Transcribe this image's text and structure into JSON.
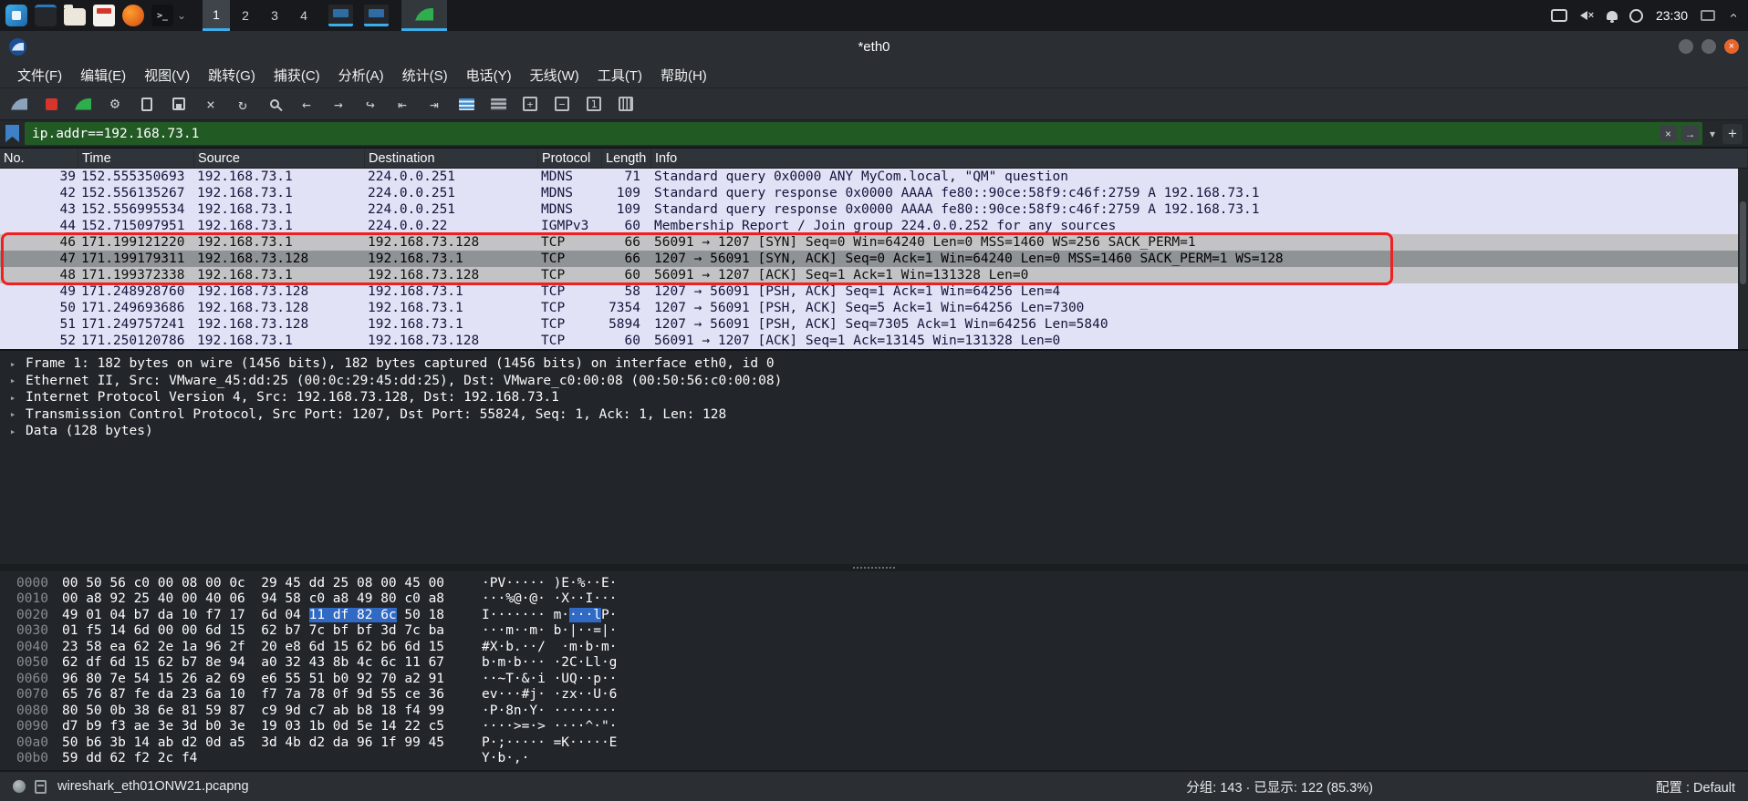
{
  "taskbar": {
    "pager": [
      {
        "id": "desktop-1",
        "label": "1",
        "active": true
      },
      {
        "id": "desktop-2",
        "label": "2",
        "active": false
      },
      {
        "id": "desktop-3",
        "label": "3",
        "active": false
      },
      {
        "id": "desktop-4",
        "label": "4",
        "active": false
      }
    ],
    "clock": "23:30"
  },
  "window": {
    "title": "*eth0"
  },
  "menu": {
    "items": [
      {
        "id": "file",
        "label": "文件(F)"
      },
      {
        "id": "edit",
        "label": "编辑(E)"
      },
      {
        "id": "view",
        "label": "视图(V)"
      },
      {
        "id": "go",
        "label": "跳转(G)"
      },
      {
        "id": "capture",
        "label": "捕获(C)"
      },
      {
        "id": "analyze",
        "label": "分析(A)"
      },
      {
        "id": "statistics",
        "label": "统计(S)"
      },
      {
        "id": "telephony",
        "label": "电话(Y)"
      },
      {
        "id": "wireless",
        "label": "无线(W)"
      },
      {
        "id": "tools",
        "label": "工具(T)"
      },
      {
        "id": "help",
        "label": "帮助(H)"
      }
    ]
  },
  "toolbar": {
    "icons": [
      {
        "name": "start-capture",
        "shape": "fin-blue"
      },
      {
        "name": "stop-capture",
        "shape": "square-red"
      },
      {
        "name": "restart-capture",
        "shape": "fin-green"
      },
      {
        "name": "capture-options",
        "shape": "gear",
        "char": "⚙"
      },
      {
        "name": "open-file",
        "shape": "doc"
      },
      {
        "name": "save-file",
        "shape": "save"
      },
      {
        "name": "close-file",
        "shape": "glyph",
        "char": "×"
      },
      {
        "name": "reload-file",
        "shape": "glyph",
        "char": "↻"
      },
      {
        "name": "find-packet",
        "shape": "magnifier"
      },
      {
        "name": "go-back",
        "shape": "glyph",
        "char": "←"
      },
      {
        "name": "go-forward",
        "shape": "glyph",
        "char": "→"
      },
      {
        "name": "go-to-packet",
        "shape": "glyph",
        "char": "↪"
      },
      {
        "name": "go-first-packet",
        "shape": "glyph",
        "char": "⇤"
      },
      {
        "name": "go-last-packet",
        "shape": "glyph",
        "char": "⇥"
      },
      {
        "name": "colorize-packets",
        "shape": "stripes-blue"
      },
      {
        "name": "auto-scroll",
        "shape": "stripes-gray"
      },
      {
        "name": "zoom-in",
        "shape": "box",
        "char": "+"
      },
      {
        "name": "zoom-out",
        "shape": "box",
        "char": "−"
      },
      {
        "name": "zoom-100",
        "shape": "box",
        "char": "1"
      },
      {
        "name": "resize-columns",
        "shape": "cols"
      }
    ]
  },
  "filter": {
    "value": "ip.addr==192.168.73.1",
    "add_button": "+"
  },
  "packet_list": {
    "columns": [
      "No.",
      "Time",
      "Source",
      "Destination",
      "Protocol",
      "Length",
      "Info"
    ],
    "rows": [
      {
        "no": "39",
        "time": "152.555350693",
        "src": "192.168.73.1",
        "dst": "224.0.0.251",
        "proto": "MDNS",
        "len": "71",
        "info": "Standard query 0x0000 ANY MyCom.local, \"QM\" question",
        "style": "mdns"
      },
      {
        "no": "42",
        "time": "152.556135267",
        "src": "192.168.73.1",
        "dst": "224.0.0.251",
        "proto": "MDNS",
        "len": "109",
        "info": "Standard query response 0x0000 AAAA fe80::90ce:58f9:c46f:2759 A 192.168.73.1",
        "style": "mdns"
      },
      {
        "no": "43",
        "time": "152.556995534",
        "src": "192.168.73.1",
        "dst": "224.0.0.251",
        "proto": "MDNS",
        "len": "109",
        "info": "Standard query response 0x0000 AAAA fe80::90ce:58f9:c46f:2759 A 192.168.73.1",
        "style": "mdns"
      },
      {
        "no": "44",
        "time": "152.715097951",
        "src": "192.168.73.1",
        "dst": "224.0.0.22",
        "proto": "IGMPv3",
        "len": "60",
        "info": "Membership Report / Join group 224.0.0.252 for any sources",
        "style": "mdns"
      },
      {
        "no": "46",
        "time": "171.199121220",
        "src": "192.168.73.1",
        "dst": "192.168.73.128",
        "proto": "TCP",
        "len": "66",
        "info": "56091 → 1207 [SYN] Seq=0 Win=64240 Len=0 MSS=1460 WS=256 SACK_PERM=1",
        "style": "syn"
      },
      {
        "no": "47",
        "time": "171.199179311",
        "src": "192.168.73.128",
        "dst": "192.168.73.1",
        "proto": "TCP",
        "len": "66",
        "info": "1207 → 56091 [SYN, ACK] Seq=0 Ack=1 Win=64240 Len=0 MSS=1460 SACK_PERM=1 WS=128",
        "style": "selected"
      },
      {
        "no": "48",
        "time": "171.199372338",
        "src": "192.168.73.1",
        "dst": "192.168.73.128",
        "proto": "TCP",
        "len": "60",
        "info": "56091 → 1207 [ACK] Seq=1 Ack=1 Win=131328 Len=0",
        "style": "syn"
      },
      {
        "no": "49",
        "time": "171.248928760",
        "src": "192.168.73.128",
        "dst": "192.168.73.1",
        "proto": "TCP",
        "len": "58",
        "info": "1207 → 56091 [PSH, ACK] Seq=1 Ack=1 Win=64256 Len=4",
        "style": "tcp"
      },
      {
        "no": "50",
        "time": "171.249693686",
        "src": "192.168.73.128",
        "dst": "192.168.73.1",
        "proto": "TCP",
        "len": "7354",
        "info": "1207 → 56091 [PSH, ACK] Seq=5 Ack=1 Win=64256 Len=7300",
        "style": "tcp"
      },
      {
        "no": "51",
        "time": "171.249757241",
        "src": "192.168.73.128",
        "dst": "192.168.73.1",
        "proto": "TCP",
        "len": "5894",
        "info": "1207 → 56091 [PSH, ACK] Seq=7305 Ack=1 Win=64256 Len=5840",
        "style": "tcp"
      },
      {
        "no": "52",
        "time": "171.250120786",
        "src": "192.168.73.1",
        "dst": "192.168.73.128",
        "proto": "TCP",
        "len": "60",
        "info": "56091 → 1207 [ACK] Seq=1 Ack=13145 Win=131328 Len=0",
        "style": "tcp"
      }
    ]
  },
  "details": {
    "rows": [
      "Frame 1: 182 bytes on wire (1456 bits), 182 bytes captured (1456 bits) on interface eth0, id 0",
      "Ethernet II, Src: VMware_45:dd:25 (00:0c:29:45:dd:25), Dst: VMware_c0:00:08 (00:50:56:c0:00:08)",
      "Internet Protocol Version 4, Src: 192.168.73.128, Dst: 192.168.73.1",
      "Transmission Control Protocol, Src Port: 1207, Dst Port: 55824, Seq: 1, Ack: 1, Len: 128",
      "Data (128 bytes)"
    ]
  },
  "hex_dump": {
    "rows": [
      {
        "o": "0000",
        "hp": "00 50 56 c0 00 08 00 0c  29 45 dd 25 08 00 45 00",
        "ap": "·PV····· )E·%··E·"
      },
      {
        "o": "0010",
        "hp": "00 a8 92 25 40 00 40 06  94 58 c0 a8 49 80 c0 a8",
        "ap": "···%@·@· ·X··I···"
      },
      {
        "o": "0020",
        "hp": "49 01 04 b7 da 10 f7 17  6d 04 ",
        "hh": "11 df 82 6c",
        "ht": " 50 18",
        "ap": "I······· m·",
        "ah": "···l",
        "at": "P·"
      },
      {
        "o": "0030",
        "hp": "01 f5 14 6d 00 00 6d 15  62 b7 7c bf bf 3d 7c ba",
        "ap": "···m··m· b·|··=|·"
      },
      {
        "o": "0040",
        "hp": "23 58 ea 62 2e 1a 96 2f  20 e8 6d 15 62 b6 6d 15",
        "ap": "#X·b.··/  ·m·b·m·"
      },
      {
        "o": "0050",
        "hp": "62 df 6d 15 62 b7 8e 94  a0 32 43 8b 4c 6c 11 67",
        "ap": "b·m·b··· ·2C·Ll·g"
      },
      {
        "o": "0060",
        "hp": "96 80 7e 54 15 26 a2 69  e6 55 51 b0 92 70 a2 91",
        "ap": "··~T·&·i ·UQ··p··"
      },
      {
        "o": "0070",
        "hp": "65 76 87 fe da 23 6a 10  f7 7a 78 0f 9d 55 ce 36",
        "ap": "ev···#j· ·zx··U·6"
      },
      {
        "o": "0080",
        "hp": "80 50 0b 38 6e 81 59 87  c9 9d c7 ab b8 18 f4 99",
        "ap": "·P·8n·Y· ········"
      },
      {
        "o": "0090",
        "hp": "d7 b9 f3 ae 3e 3d b0 3e  19 03 1b 0d 5e 14 22 c5",
        "ap": "····>=·> ····^·\"·"
      },
      {
        "o": "00a0",
        "hp": "50 b6 3b 14 ab d2 0d a5  3d 4b d2 da 96 1f 99 45",
        "ap": "P·;····· =K·····E"
      },
      {
        "o": "00b0",
        "hp": "59 dd 62 f2 2c f4",
        "ap": "Y·b·,·"
      }
    ]
  },
  "status_bar": {
    "filename": "wireshark_eth01ONW21.pcapng",
    "packet_stats": "分组: 143 · 已显示: 122 (85.3%)",
    "profile": "配置 : Default"
  }
}
